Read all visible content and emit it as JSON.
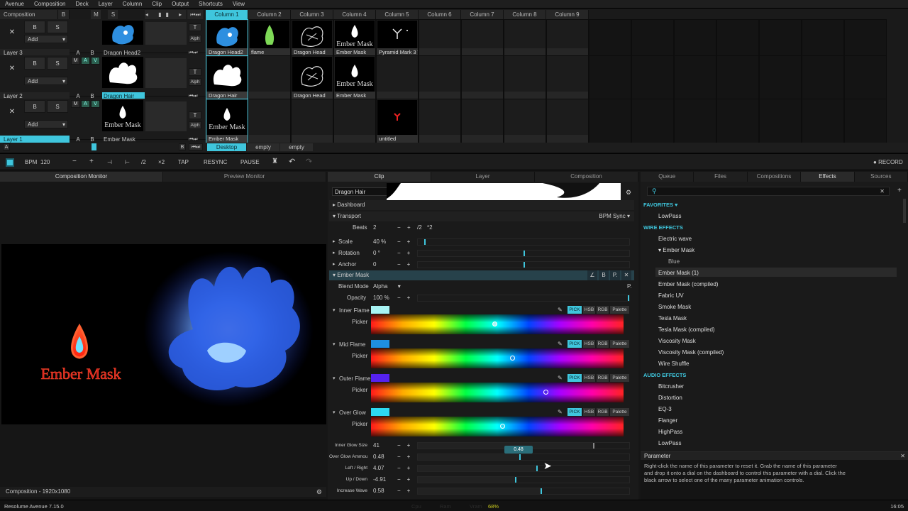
{
  "menu": [
    "Avenue",
    "Composition",
    "Deck",
    "Layer",
    "Column",
    "Clip",
    "Output",
    "Shortcuts",
    "View"
  ],
  "deck": {
    "composition_label": "Composition",
    "columns": [
      "Column 1",
      "Column 2",
      "Column 3",
      "Column 4",
      "Column 5",
      "Column 6",
      "Column 7",
      "Column 8",
      "Column 9"
    ],
    "active_column": "Column 1"
  },
  "layers": [
    {
      "name": "Layer 3",
      "blend": "Add",
      "clips": [
        "Dragon Head2",
        "flame",
        "Dragon Head",
        "Ember Mask",
        "Pyramid Mark 3 T..."
      ],
      "current": "Dragon Head2"
    },
    {
      "name": "Layer 2",
      "blend": "Add",
      "clips": [
        "Dragon Hair",
        "",
        "Dragon Head",
        "Ember Mask",
        ""
      ],
      "current": "Dragon Hair"
    },
    {
      "name": "Layer 1",
      "blend": "Add",
      "clips": [
        "Ember Mask",
        "",
        "",
        "",
        "untitled"
      ],
      "current": "Ember Mask"
    }
  ],
  "layer_buttons": {
    "b": "B",
    "s": "S",
    "x": "✕",
    "m": "M",
    "a": "A",
    "v": "V",
    "t": "T",
    "alph": "Alph"
  },
  "decks": {
    "a": "A",
    "b": "B",
    "names": [
      "Desktop",
      "empty",
      "empty"
    ]
  },
  "thumb_text": {
    "ember": "Ember Mask"
  },
  "transport": {
    "bpm_label": "BPM",
    "bpm": "120",
    "minus": "−",
    "plus": "+",
    "half": "/2",
    "double": "×2",
    "tap": "TAP",
    "resync": "RESYNC",
    "pause": "PAUSE",
    "record": "RECORD"
  },
  "monitor": {
    "tabs": [
      "Composition Monitor",
      "Preview Monitor"
    ],
    "footer": "Composition - 1920x1080",
    "logo_text": "Ember Mask"
  },
  "clip_panel": {
    "tabs": [
      "Clip",
      "Layer",
      "Composition"
    ],
    "clip_name": "Dragon Hair",
    "dashboard": "Dashboard",
    "transport": "Transport",
    "bpm_sync": "BPM Sync",
    "beats_label": "Beats",
    "beats": "2",
    "beats_ops": [
      "−",
      "+",
      "/2",
      "*2"
    ],
    "params": [
      {
        "name": "Scale",
        "value": "40 %",
        "level": 0.03
      },
      {
        "name": "Rotation",
        "value": "0 °",
        "level": 0.5
      },
      {
        "name": "Anchor",
        "value": "0",
        "level": 0.5
      }
    ],
    "effect": {
      "name": "Ember Mask",
      "icons": [
        "∠",
        "B",
        "P.",
        "✕"
      ],
      "blend_label": "Blend Mode",
      "blend": "Alpha",
      "p_label": "P.",
      "opacity_label": "Opacity",
      "opacity": "100 %",
      "picker_label": "Picker",
      "pick_buttons": [
        "PICK",
        "HSB",
        "RGB",
        "Palette"
      ],
      "colors": [
        {
          "name": "Inner Flame",
          "swatch": "#a8f4f4",
          "pick": 0.49
        },
        {
          "name": "Mid Flame",
          "swatch": "#1e8fe0",
          "pick": 0.56
        },
        {
          "name": "Outer Flame",
          "swatch": "#5522ee",
          "pick": 0.69
        },
        {
          "name": "Over Glow",
          "swatch": "#2dd9f2",
          "pick": 0.52
        }
      ],
      "sliders": [
        {
          "name": "Inner Glow Size",
          "value": "41",
          "level": 0.83
        },
        {
          "name": "Over Glow Ammou...",
          "value": "0.48",
          "level": 0.48,
          "tooltip": "0.48"
        },
        {
          "name": "Left / Right",
          "value": "4.07",
          "level": 0.56
        },
        {
          "name": "Up / Down",
          "value": "-4.91",
          "level": 0.46
        },
        {
          "name": "Increase Wave",
          "value": "0.58",
          "level": 0.58
        }
      ]
    }
  },
  "browser": {
    "tabs": [
      "Queue",
      "Files",
      "Compositions",
      "Effects",
      "Sources"
    ],
    "active": "Effects",
    "sections": [
      {
        "title": "FAVORITES ♥",
        "items": [
          {
            "t": "LowPass",
            "i": 0
          }
        ]
      },
      {
        "title": "WIRE EFFECTS",
        "items": [
          {
            "t": "Electric wave",
            "i": 0
          },
          {
            "t": "▾ Ember Mask",
            "i": 0
          },
          {
            "t": "Blue",
            "i": 1
          },
          {
            "t": "Ember Mask (1)",
            "i": 0,
            "sel": true
          },
          {
            "t": "Ember Mask (compiled)",
            "i": 0
          },
          {
            "t": "Fabric UV",
            "i": 0
          },
          {
            "t": "Smoke Mask",
            "i": 0
          },
          {
            "t": "Tesla Mask",
            "i": 0
          },
          {
            "t": "Tesla Mask (compiled)",
            "i": 0
          },
          {
            "t": "Viscosity Mask",
            "i": 0
          },
          {
            "t": "Viscosity Mask (compiled)",
            "i": 0
          },
          {
            "t": "Wire Shuffle",
            "i": 0
          }
        ]
      },
      {
        "title": "AUDIO EFFECTS",
        "items": [
          {
            "t": "Bitcrusher",
            "i": 0
          },
          {
            "t": "Distortion",
            "i": 0
          },
          {
            "t": "EQ-3",
            "i": 0
          },
          {
            "t": "Flanger",
            "i": 0
          },
          {
            "t": "HighPass",
            "i": 0
          },
          {
            "t": "LowPass",
            "i": 0
          }
        ]
      }
    ]
  },
  "help": {
    "title": "Parameter",
    "text": "Right-click the name of this parameter to reset it. Grab the name of this parameter and drop it onto a dial on the dashboard to control this parameter with a dial. Click the black arrow to select one of the many parameter animation controls."
  },
  "status": {
    "version": "Resolume Avenue 7.15.0",
    "cpu": "Cpu",
    "ram": "Ram",
    "vram": "Vram",
    "vram_val": "68%",
    "time": "16:05"
  },
  "colors": {
    "accent": "#3fc6dd",
    "bg": "#161616"
  }
}
